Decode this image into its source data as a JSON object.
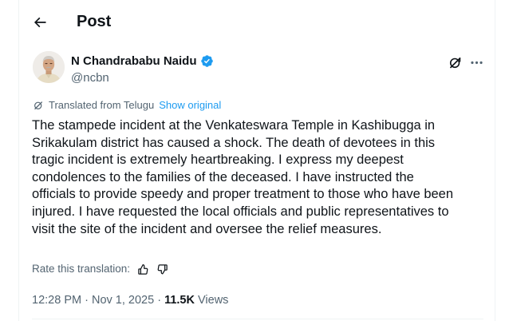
{
  "header": {
    "back_icon": "arrow-left-icon",
    "title": "Post"
  },
  "author": {
    "name": "N Chandrababu Naidu",
    "handle": "@ncbn",
    "verified_color": "#1d9bf0",
    "avatar_icon": "profile-photo"
  },
  "actions": {
    "grok_icon": "grok-icon",
    "more_icon": "more-horizontal-icon"
  },
  "translation": {
    "icon": "translate-globe-icon",
    "label": "Translated from Telugu",
    "show_original": "Show original"
  },
  "tweet": {
    "text": "The stampede incident at the Venkateswara Temple in Kashibugga in\nSrikakulam district has caused a shock. The death of devotees in this\ntragic incident is extremely heartbreaking. I express my deepest\ncondolences to the families of the deceased. I have instructed the\nofficials to provide speedy and proper treatment to those who have been\ninjured. I have requested the local officials and public representatives to\nvisit the site of the incident and oversee the relief measures."
  },
  "rate": {
    "label": "Rate this translation:",
    "thumbs_up_icon": "thumbs-up-icon",
    "thumbs_down_icon": "thumbs-down-icon"
  },
  "meta": {
    "time": "12:28 PM",
    "separator": " · ",
    "date": "Nov 1, 2025",
    "views_count": "11.5K",
    "views_label": " Views"
  },
  "colors": {
    "text": "#0f1419",
    "secondary": "#536471",
    "link": "#1d9bf0",
    "divider": "#eff3f4"
  }
}
